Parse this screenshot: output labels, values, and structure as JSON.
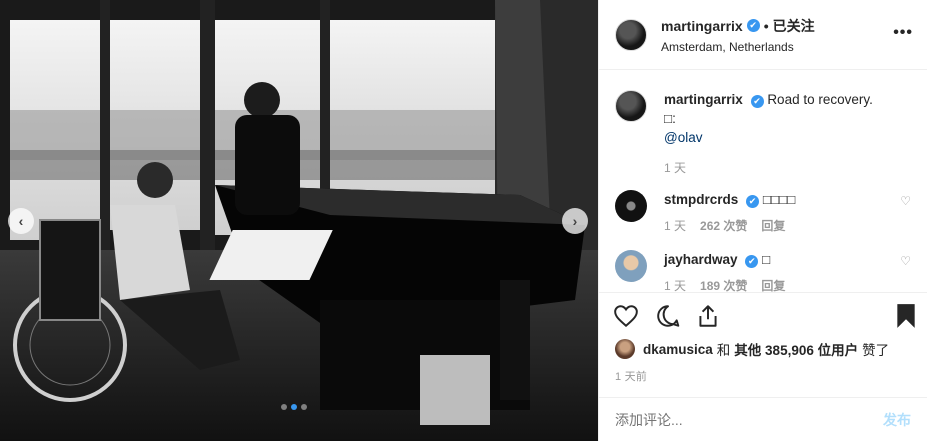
{
  "post": {
    "photo_alt": "",
    "slides_total": 3,
    "slide_active": 2,
    "prev_icon": "chevron-left-icon",
    "next_icon": "chevron-right-icon",
    "prev_glyph": "‹",
    "next_glyph": "›"
  },
  "header": {
    "username": "martingarrix",
    "verified_glyph": "✔",
    "dot": "•",
    "follow_state": "已关注",
    "location": "Amsterdam, Netherlands",
    "more_glyph": "•••"
  },
  "comments": [
    {
      "username": "martingarrix",
      "text": "Road to recovery. □:",
      "mention": "@olav",
      "time": "1 天",
      "likes": "",
      "reply": ""
    },
    {
      "username": "stmpdrcrds",
      "text": "□□□□",
      "mention": "",
      "time": "1 天",
      "likes": "262 次赞",
      "reply": "回复"
    },
    {
      "username": "jayhardway",
      "text": "□",
      "mention": "",
      "time": "1 天",
      "likes": "189 次赞",
      "reply": "回复"
    }
  ],
  "actions": {
    "like_icon": "heart-icon",
    "comment_icon": "comment-icon",
    "share_icon": "share-icon",
    "save_icon": "bookmark-icon"
  },
  "likes": {
    "user": "dkamusica",
    "connector": "和",
    "others_label": "其他 385,906 位用户",
    "suffix": "赞了"
  },
  "timestamp": "1 天前",
  "composer": {
    "placeholder": "添加评论...",
    "post_label": "发布"
  },
  "colors": {
    "accent": "#3897f0",
    "post_disabled": "#b2dffc",
    "border": "#efefef",
    "meta": "#999999"
  }
}
